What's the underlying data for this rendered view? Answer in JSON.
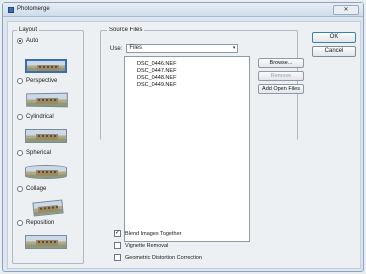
{
  "window": {
    "title": "Photomerge",
    "close_label": "✕"
  },
  "layout": {
    "label": "Layout",
    "options": [
      {
        "label": "Auto",
        "selected": true
      },
      {
        "label": "Perspective",
        "selected": false
      },
      {
        "label": "Cylindrical",
        "selected": false
      },
      {
        "label": "Spherical",
        "selected": false
      },
      {
        "label": "Collage",
        "selected": false
      },
      {
        "label": "Reposition",
        "selected": false
      }
    ]
  },
  "source": {
    "label": "Source Files",
    "use_label": "Use:",
    "use_value": "Files",
    "files": [
      "DSC_0446.NEF",
      "DSC_0447.NEF",
      "DSC_0448.NEF",
      "DSC_0449.NEF"
    ],
    "browse_label": "Browse...",
    "remove_label": "Remove",
    "add_open_label": "Add Open Files"
  },
  "actions": {
    "ok_label": "OK",
    "cancel_label": "Cancel"
  },
  "options": {
    "blend": {
      "label": "Blend Images Together",
      "checked": true
    },
    "vignette": {
      "label": "Vignette Removal",
      "checked": false
    },
    "distortion": {
      "label": "Geometric Distortion Correction",
      "checked": false
    }
  },
  "icons": {
    "checkmark": "✓",
    "dropdown_arrow": "▾"
  }
}
